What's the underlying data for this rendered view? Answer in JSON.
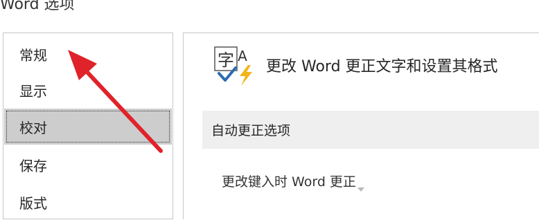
{
  "window": {
    "title": "Word 选项"
  },
  "sidebar": {
    "items": [
      {
        "label": "常规",
        "selected": false
      },
      {
        "label": "显示",
        "selected": false
      },
      {
        "label": "校对",
        "selected": true
      },
      {
        "label": "保存",
        "selected": false
      },
      {
        "label": "版式",
        "selected": false
      }
    ]
  },
  "main": {
    "header": {
      "icon": "abc-check-icon",
      "icon_char": "字",
      "icon_letter": "A",
      "text": "更改 Word 更正文字和设置其格式"
    },
    "section": {
      "title": "自动更正选项"
    },
    "subsection": {
      "label": "更改键入时 Word 更正"
    }
  },
  "colors": {
    "selected_bg": "#cdcdcd",
    "section_bg": "#efefef",
    "annotation_arrow": "#e0232a",
    "icon_blue": "#2b6cb0",
    "icon_yellow": "#f3b41b"
  }
}
